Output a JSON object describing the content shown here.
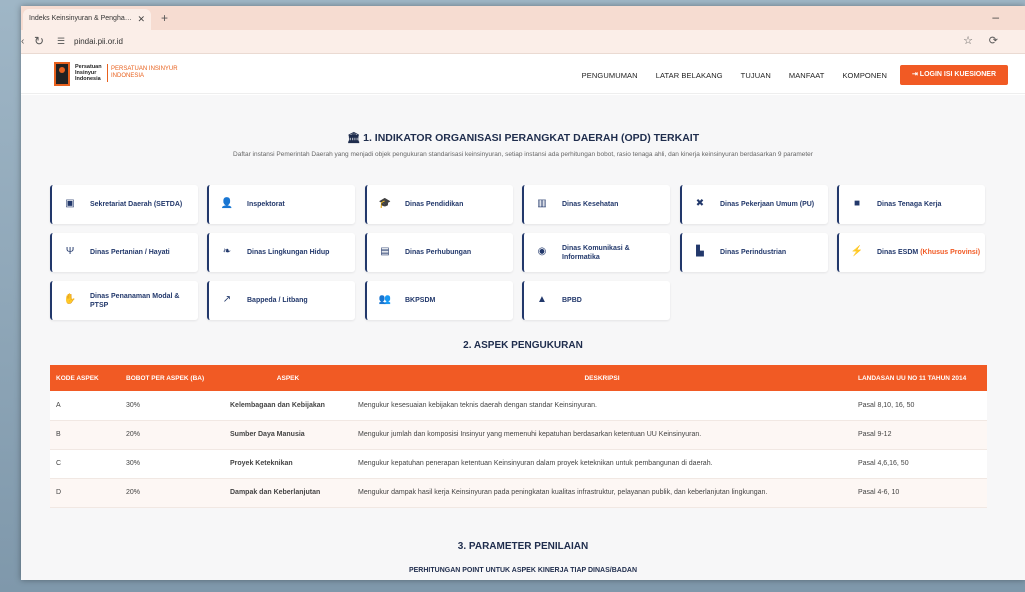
{
  "browser": {
    "tab_title": "Indeks Keinsinyuran & Pengha…",
    "url": "pindai.pii.or.id"
  },
  "header": {
    "logo_name": "Persatuan Insinyur Indonesia",
    "logo_org": "PERSATUAN INSINYUR INDONESIA",
    "nav": [
      "PENGUMUMAN",
      "LATAR BELAKANG",
      "TUJUAN",
      "MANFAAT",
      "KOMPONEN"
    ],
    "login_label": "LOGIN ISI KUESIONER"
  },
  "section1": {
    "title": "1. INDIKATOR ORGANISASI PERANGKAT DAERAH (OPD) TERKAIT",
    "subtitle": "Daftar instansi Pemerintah Daerah yang menjadi objek pengukuran standarisasi keinsinyuran, setiap instansi ada perhitungan bobot, rasio tenaga ahli, dan kinerja keinsinyuran berdasarkan 9 parameter",
    "cards": [
      {
        "label": "Sekretariat Daerah (SETDA)",
        "icon": "building-icon"
      },
      {
        "label": "Inspektorat",
        "icon": "user-search-icon"
      },
      {
        "label": "Dinas Pendidikan",
        "icon": "graduation-cap-icon"
      },
      {
        "label": "Dinas Kesehatan",
        "icon": "hospital-icon"
      },
      {
        "label": "Dinas Pekerjaan Umum (PU)",
        "icon": "tools-icon"
      },
      {
        "label": "Dinas Tenaga Kerja",
        "icon": "briefcase-icon"
      },
      {
        "label": "Dinas Pertanian / Hayati",
        "icon": "seedling-icon"
      },
      {
        "label": "Dinas Lingkungan Hidup",
        "icon": "leaf-icon"
      },
      {
        "label": "Dinas Perhubungan",
        "icon": "bus-icon"
      },
      {
        "label": "Dinas Komunikasi & Informatika",
        "icon": "chip-icon"
      },
      {
        "label": "Dinas Perindustrian",
        "icon": "factory-icon"
      },
      {
        "label": "Dinas ESDM",
        "extra": "(Khusus Provinsi)",
        "icon": "bolt-icon"
      },
      {
        "label": "Dinas Penanaman Modal & PTSP",
        "icon": "hand-coin-icon"
      },
      {
        "label": "Bappeda / Litbang",
        "icon": "chart-line-icon"
      },
      {
        "label": "BKPSDM",
        "icon": "users-icon"
      },
      {
        "label": "BPBD",
        "icon": "warning-icon"
      }
    ]
  },
  "section2": {
    "title": "2. ASPEK PENGUKURAN",
    "headers": [
      "KODE ASPEK",
      "BOBOT PER ASPEK (BA)",
      "ASPEK",
      "DESKRIPSI",
      "LANDASAN UU NO 11 TAHUN 2014"
    ],
    "rows": [
      {
        "kode": "A",
        "bobot": "30%",
        "aspek": "Kelembagaan dan Kebijakan",
        "deskripsi": "Mengukur kesesuaian kebijakan teknis daerah dengan standar Keinsinyuran.",
        "landasan": "Pasal 8,10, 16, 50"
      },
      {
        "kode": "B",
        "bobot": "20%",
        "aspek": "Sumber Daya Manusia",
        "deskripsi": "Mengukur jumlah dan komposisi Insinyur yang memenuhi kepatuhan berdasarkan ketentuan UU Keinsinyuran.",
        "landasan": "Pasal 9-12"
      },
      {
        "kode": "C",
        "bobot": "30%",
        "aspek": "Proyek Keteknikan",
        "deskripsi": "Mengukur kepatuhan penerapan ketentuan Keinsinyuran dalam proyek keteknikan untuk pembangunan di daerah.",
        "landasan": "Pasal 4,6,16, 50"
      },
      {
        "kode": "D",
        "bobot": "20%",
        "aspek": "Dampak dan Keberlanjutan",
        "deskripsi": "Mengukur dampak hasil kerja Keinsinyuran pada peningkatan kualitas infrastruktur, pelayanan publik, dan keberlanjutan lingkungan.",
        "landasan": "Pasal 4-6, 10"
      }
    ]
  },
  "section3": {
    "title": "3. PARAMETER PENILAIAN",
    "subtitle": "PERHITUNGAN POINT UNTUK ASPEK KINERJA TIAP DINAS/BADAN"
  }
}
